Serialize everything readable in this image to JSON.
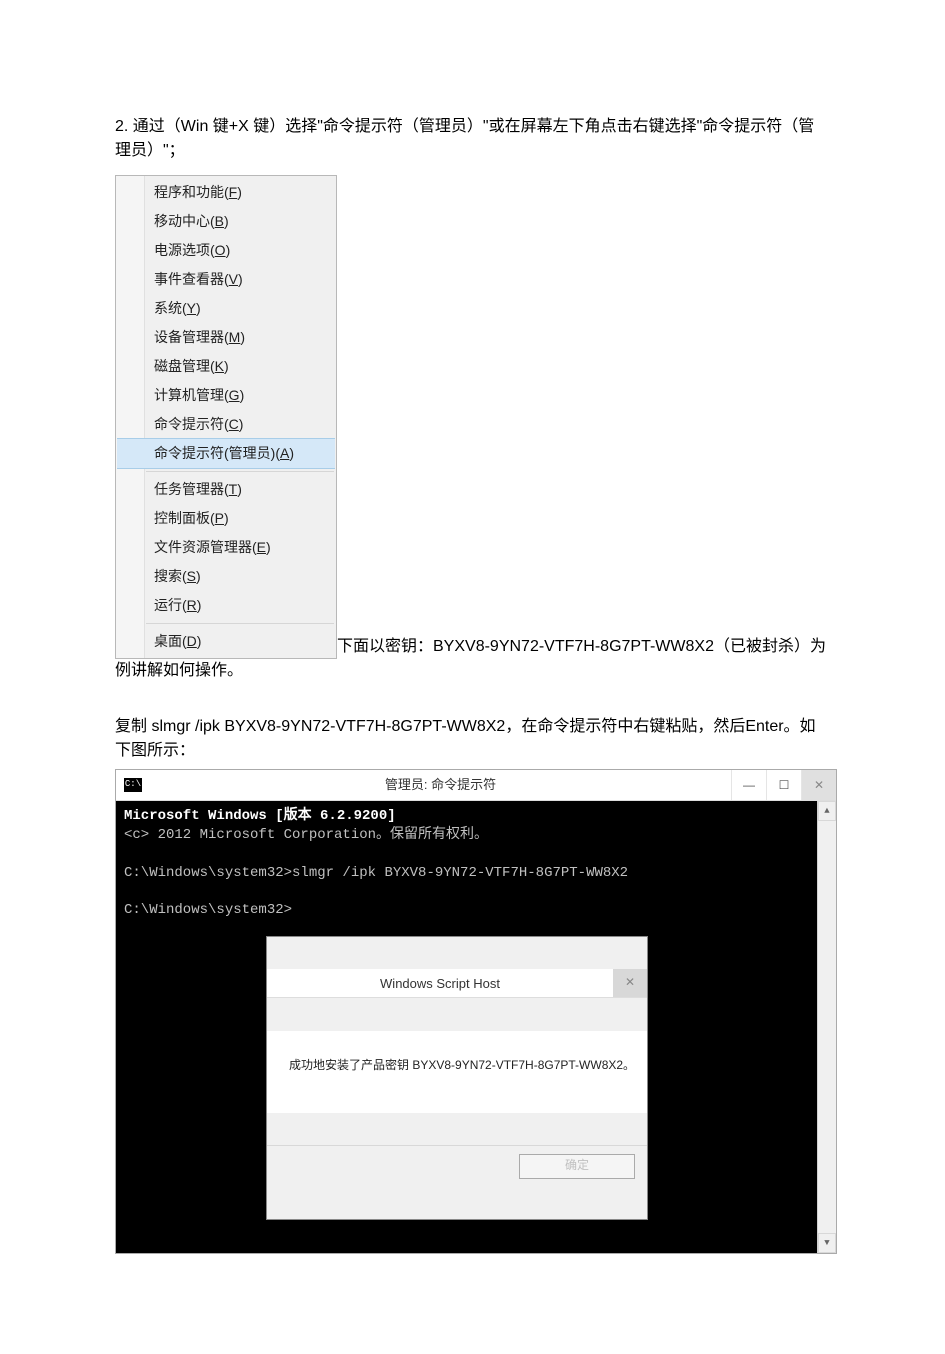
{
  "step_text": "2. 通过（Win 键+X 键）选择\"命令提示符（管理员）\"或在屏幕左下角点击右键选择\"命令提示符（管理员）\"；",
  "menu": {
    "groups": [
      [
        {
          "label": "程序和功能",
          "hot": "F"
        },
        {
          "label": "移动中心",
          "hot": "B"
        },
        {
          "label": "电源选项",
          "hot": "O"
        },
        {
          "label": "事件查看器",
          "hot": "V"
        },
        {
          "label": "系统",
          "hot": "Y"
        },
        {
          "label": "设备管理器",
          "hot": "M"
        },
        {
          "label": "磁盘管理",
          "hot": "K"
        },
        {
          "label": "计算机管理",
          "hot": "G"
        },
        {
          "label": "命令提示符",
          "hot": "C"
        },
        {
          "label": "命令提示符(管理员)",
          "hot": "A",
          "selected": true
        }
      ],
      [
        {
          "label": "任务管理器",
          "hot": "T"
        },
        {
          "label": "控制面板",
          "hot": "P"
        },
        {
          "label": "文件资源管理器",
          "hot": "E"
        },
        {
          "label": "搜索",
          "hot": "S"
        },
        {
          "label": "运行",
          "hot": "R"
        }
      ],
      [
        {
          "label": "桌面",
          "hot": "D"
        }
      ]
    ]
  },
  "after_menu": "下面以密钥：BYXV8-9YN72-VTF7H-8G7PT-WW8X2（已被封杀）为例讲解如何操作。",
  "para3": "复制 slmgr  /ipk  BYXV8-9YN72-VTF7H-8G7PT-WW8X2，在命令提示符中右键粘贴，然后Enter。如下图所示：",
  "cmd": {
    "icon_text": "C:\\",
    "title": "管理员: 命令提示符",
    "lines": [
      "Microsoft Windows [版本 6.2.9200]",
      "<c> 2012 Microsoft Corporation。保留所有权利。",
      "",
      "C:\\Windows\\system32>slmgr /ipk BYXV8-9YN72-VTF7H-8G7PT-WW8X2",
      "",
      "C:\\Windows\\system32>"
    ],
    "minimize": "—",
    "maximize": "☐",
    "close": "✕"
  },
  "dialog": {
    "title": "Windows Script Host",
    "message": "成功地安装了产品密钥 BYXV8-9YN72-VTF7H-8G7PT-WW8X2。",
    "ok": "确定",
    "close": "✕"
  },
  "scroll": {
    "up": "▲",
    "down": "▼"
  }
}
